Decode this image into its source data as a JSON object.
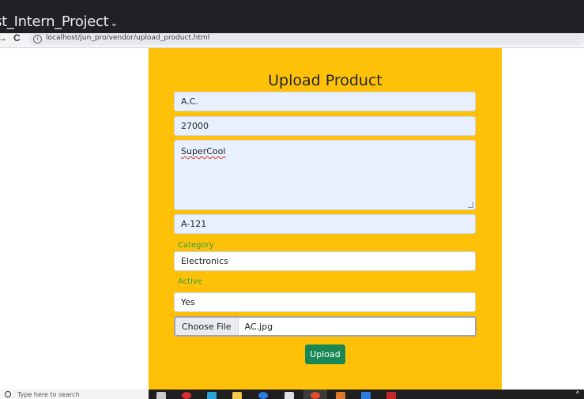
{
  "window": {
    "title": "rst_Intern_Project",
    "chevron": "⌄"
  },
  "browser": {
    "back_icon": "back-arrow-icon",
    "reload_icon": "reload-icon",
    "url": "localhost/jun_pro/vendor/upload_product.html"
  },
  "form": {
    "title": "Upload Product",
    "name_value": "A.C.",
    "price_value": "27000",
    "description_value": "SuperCool",
    "code_value": "A-121",
    "category_label": "Category",
    "category_value": "Electronics",
    "active_label": "Active",
    "active_value": "Yes",
    "file_button_label": "Choose File",
    "file_name": "AC.jpg",
    "submit_label": "Upload"
  },
  "taskbar": {
    "search_placeholder": "Type here to search"
  },
  "colors": {
    "panel": "#ffc107",
    "label": "#28a745",
    "submit": "#198754",
    "autofill": "#e8f0fe"
  }
}
